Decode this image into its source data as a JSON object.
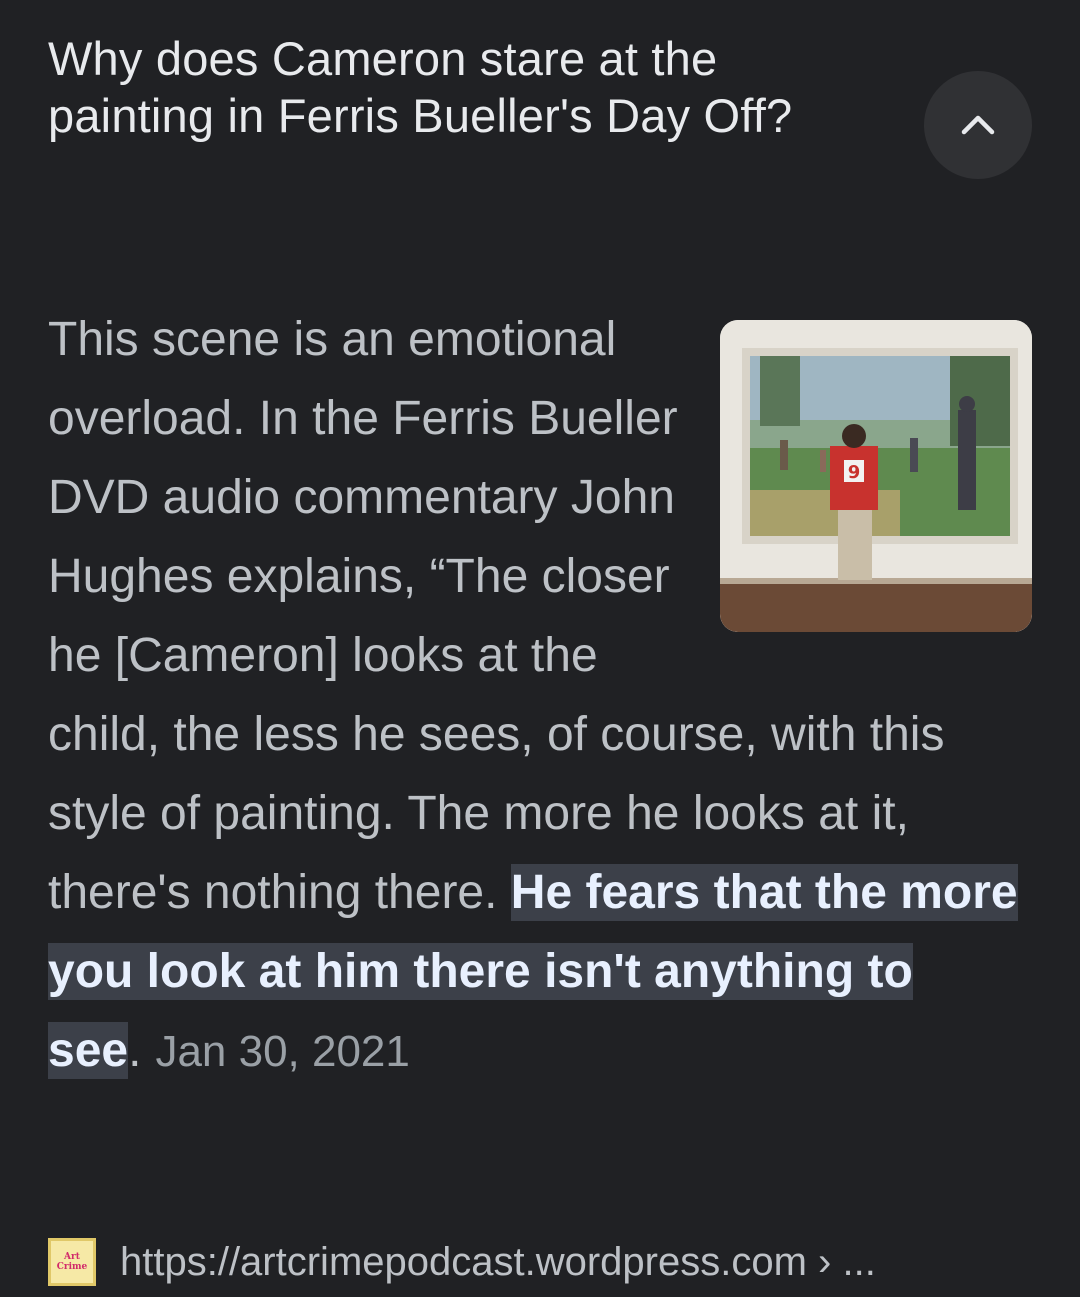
{
  "question": "Why does Cameron stare at the painting in Ferris Bueller's Day Off?",
  "collapse_icon": "chevron-up-icon",
  "snippet": {
    "text_before": "This scene is an emotional overload. In the Ferris Bueller DVD audio commentary John Hughes explains, “The closer he [Cameron] looks at the child, the less he sees, of course, with this style of painting. The more he looks at it, there's nothing there. ",
    "highlight": "He fears that the more you look at him there isn't anything to see",
    "text_after": ".",
    "date": "Jan 30, 2021"
  },
  "source": {
    "favicon_line1": "Art",
    "favicon_line2": "Crime",
    "url": "https://artcrimepodcast.wordpress.com › ..."
  },
  "colors": {
    "background": "#202124",
    "highlight_bg": "#3c4049",
    "text": "#bdc1c6",
    "title": "#e8eaed"
  }
}
